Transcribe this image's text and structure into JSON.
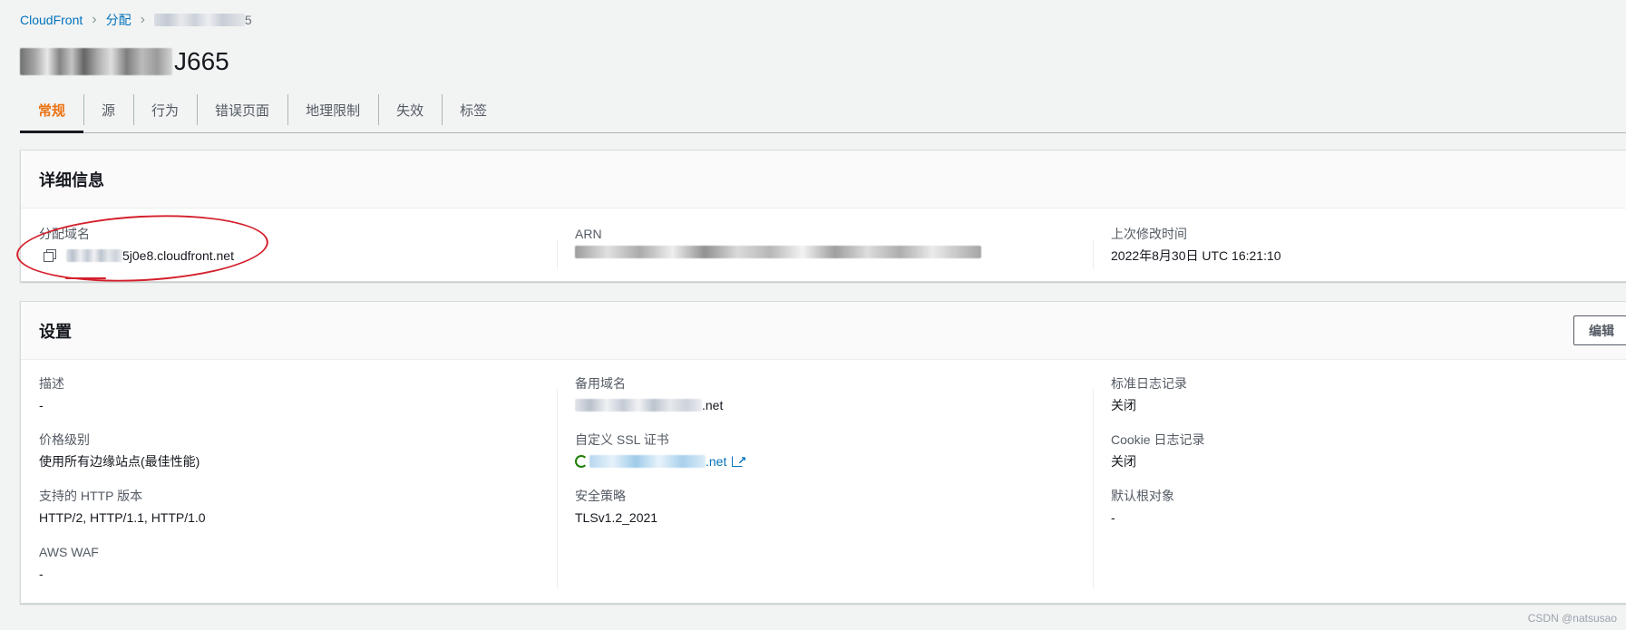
{
  "breadcrumb": {
    "items": [
      "CloudFront",
      "分配"
    ],
    "current_tail": "5"
  },
  "title": {
    "visible_suffix": "J665"
  },
  "tabs": [
    {
      "label": "常规",
      "active": true
    },
    {
      "label": "源"
    },
    {
      "label": "行为"
    },
    {
      "label": "错误页面"
    },
    {
      "label": "地理限制"
    },
    {
      "label": "失效"
    },
    {
      "label": "标签"
    }
  ],
  "details": {
    "title": "详细信息",
    "domain_label": "分配域名",
    "domain_value_suffix": "5j0e8.cloudfront.net",
    "arn_label": "ARN",
    "modified_label": "上次修改时间",
    "modified_value": "2022年8月30日 UTC 16:21:10"
  },
  "settings": {
    "title": "设置",
    "edit_label": "编辑",
    "col1": [
      {
        "label": "描述",
        "value": "-"
      },
      {
        "label": "价格级别",
        "value": "使用所有边缘站点(最佳性能)"
      },
      {
        "label": "支持的 HTTP 版本",
        "value": "HTTP/2, HTTP/1.1, HTTP/1.0"
      },
      {
        "label": "AWS WAF",
        "value": "-"
      }
    ],
    "col2": [
      {
        "label": "备用域名",
        "value_suffix": ".net"
      },
      {
        "label": "自定义 SSL 证书",
        "value_suffix": ".net"
      },
      {
        "label": "安全策略",
        "value": "TLSv1.2_2021"
      }
    ],
    "col3": [
      {
        "label": "标准日志记录",
        "value": "关闭"
      },
      {
        "label": "Cookie 日志记录",
        "value": "关闭"
      },
      {
        "label": "默认根对象",
        "value": "-"
      }
    ]
  },
  "watermark": "CSDN @natsusao",
  "colors": {
    "accent_tab": "#ec7211",
    "link": "#0073bb",
    "annotation": "#d4202c",
    "cert_ok": "#1d8102"
  }
}
